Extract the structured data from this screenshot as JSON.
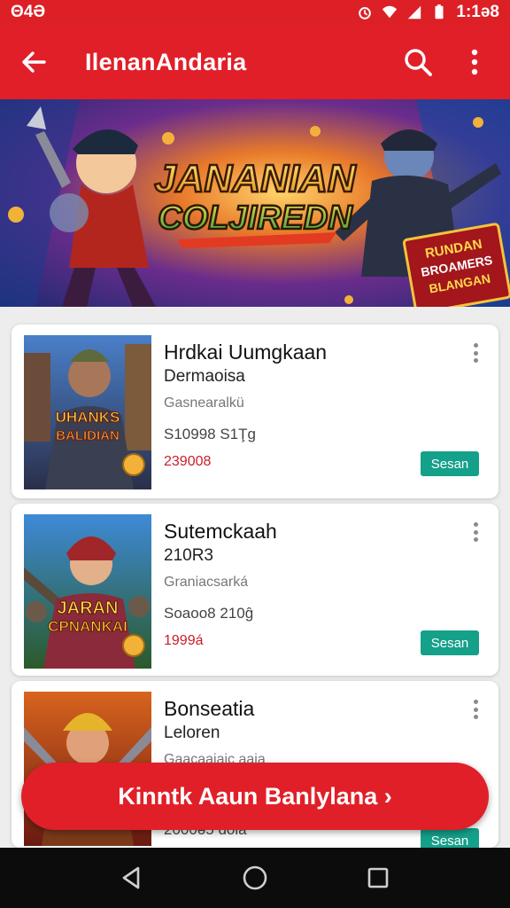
{
  "status_bar": {
    "left_text": "Θ4Ə",
    "time": "1:1ə8"
  },
  "app_bar": {
    "title": "IlenanAndaria"
  },
  "banner": {
    "headline_line1": "JANANIAN",
    "headline_line2": "COLJIREDN",
    "badge_line1": "RUNDAN",
    "badge_line2": "BROAMERS",
    "badge_line3": "BLANGAN"
  },
  "cards": [
    {
      "name": "Hrdkai Uumgkaan",
      "subtitle": "Dermaoisa",
      "meta": "Gasnearalkü",
      "meta2": "S10998 S1Ţg",
      "price": "239008",
      "button": "Sesan",
      "art_text_line1": "UHANKS",
      "art_text_line2": "BALIDIAN"
    },
    {
      "name": "Sutemckaah",
      "subtitle": "210R3",
      "meta": "Graniacsarká",
      "meta2": "Soaoo8 210ĝ",
      "price": "1999á",
      "button": "Sesan",
      "art_text_line1": "JARAN",
      "art_text_line2": "CPNANKAI"
    },
    {
      "name": "Bonseatia",
      "subtitle": "Leloren",
      "meta": "Gaacaaiaic aaia",
      "meta2": "2000ə5 ɑoia",
      "button": "Sesan"
    }
  ],
  "cta": {
    "label": "Kinntk Aaun Banlylana ›"
  },
  "colors": {
    "primary": "#e11f28",
    "button_teal": "#15a08a",
    "price": "#c81e2a"
  }
}
